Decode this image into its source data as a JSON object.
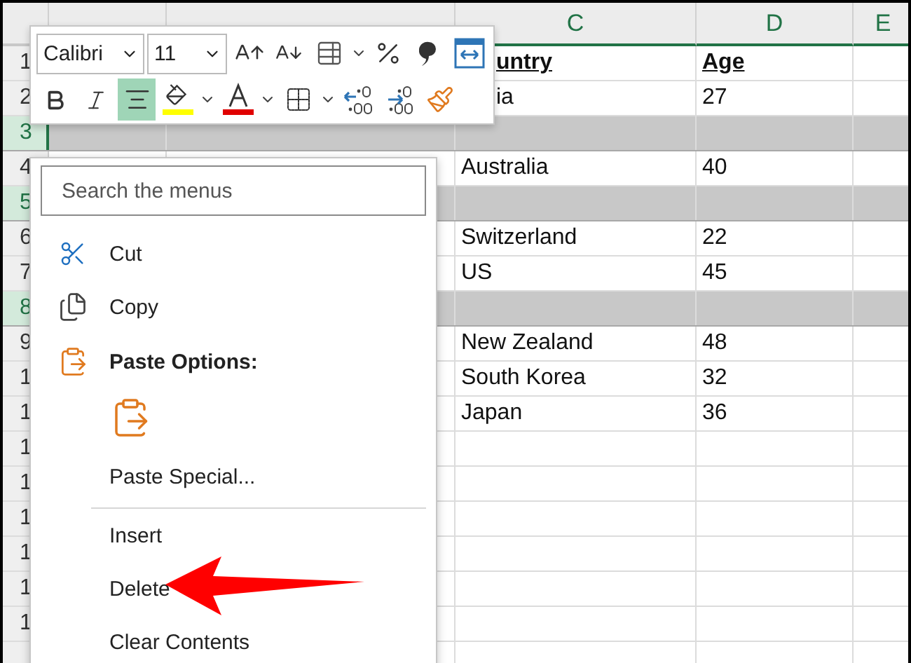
{
  "column_headers": [
    "C",
    "D",
    "E"
  ],
  "rows": [
    {
      "number": "1",
      "selected": false,
      "kind": "header",
      "c": "untry",
      "d": "Age"
    },
    {
      "number": "2",
      "selected": false,
      "kind": "data",
      "c": "ia",
      "d": "27"
    },
    {
      "number": "3",
      "selected": true,
      "kind": "data"
    },
    {
      "number": "4",
      "selected": false,
      "kind": "data",
      "c": "Australia",
      "d": "40"
    },
    {
      "number": "5",
      "selected": true,
      "kind": "data"
    },
    {
      "number": "6",
      "selected": false,
      "kind": "data",
      "c": "Switzerland",
      "d": "22"
    },
    {
      "number": "7",
      "selected": false,
      "kind": "data",
      "c": "US",
      "d": "45"
    },
    {
      "number": "8",
      "selected": true,
      "kind": "data"
    },
    {
      "number": "9",
      "selected": false,
      "kind": "data",
      "c": "New Zealand",
      "d": "48"
    },
    {
      "number": "1",
      "selected": false,
      "kind": "data",
      "c": "South Korea",
      "d": "32"
    },
    {
      "number": "1",
      "selected": false,
      "kind": "data",
      "c": "Japan",
      "d": "36"
    },
    {
      "number": "1",
      "selected": false,
      "kind": "data"
    },
    {
      "number": "1",
      "selected": false,
      "kind": "data"
    },
    {
      "number": "1",
      "selected": false,
      "kind": "data"
    },
    {
      "number": "1",
      "selected": false,
      "kind": "data"
    },
    {
      "number": "1",
      "selected": false,
      "kind": "data"
    },
    {
      "number": "1",
      "selected": false,
      "kind": "data"
    },
    {
      "selected": false,
      "kind": "data"
    }
  ],
  "mini_toolbar": {
    "font": "Calibri",
    "size": "11",
    "align_center": {
      "selected": true
    }
  },
  "context_menu": {
    "search": {
      "placeholder": "Search the menus"
    },
    "items": [
      {
        "kind": "command",
        "label": "Cut"
      },
      {
        "kind": "command",
        "label": "Copy"
      },
      {
        "kind": "heading",
        "label": "Paste Options:"
      },
      {
        "kind": "paste-option"
      },
      {
        "kind": "command",
        "label": "Paste Special..."
      },
      {
        "kind": "separator"
      },
      {
        "kind": "command",
        "label": "Insert"
      },
      {
        "kind": "command",
        "label": "Delete"
      },
      {
        "kind": "command",
        "label": "Clear Contents"
      }
    ]
  }
}
